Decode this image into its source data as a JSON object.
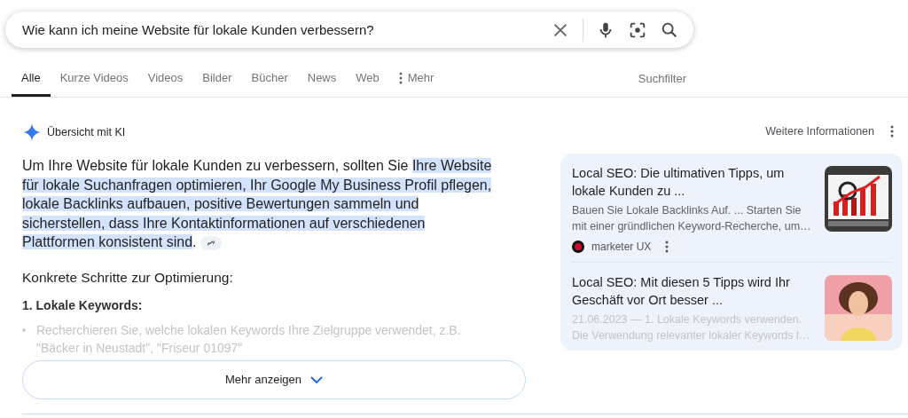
{
  "search": {
    "value": "Wie kann ich meine Website für lokale Kunden verbessern?"
  },
  "tabs": [
    {
      "label": "Alle",
      "selected": true
    },
    {
      "label": "Kurze Videos",
      "selected": false
    },
    {
      "label": "Videos",
      "selected": false
    },
    {
      "label": "Bilder",
      "selected": false
    },
    {
      "label": "Bücher",
      "selected": false
    },
    {
      "label": "News",
      "selected": false
    },
    {
      "label": "Web",
      "selected": false
    },
    {
      "label": "Mehr",
      "selected": false,
      "kind": "more"
    }
  ],
  "filter": "Suchfilter",
  "overview": {
    "title": "Übersicht mit KI",
    "more_info": "Weitere Informationen",
    "answer": [
      {
        "text": "Um Ihre Website für lokale Kunden zu verbessern, sollten Sie ",
        "highlighted": false
      },
      {
        "text": "Ihre Website für lokale Suchanfragen optimieren, Ihr Google My Business Profil pflegen, lokale Backlinks aufbauen, positive Bewertungen sammeln und sicherstellen, dass Ihre Kontaktinformationen auf verschiedenen Plattformen konsistent sind",
        "highlighted": true
      },
      {
        "text": ".",
        "highlighted": false
      }
    ],
    "heading": "Konkrete Schritte zur Optimierung:",
    "step": "1. Lokale Keywords:",
    "bullet": "Recherchieren Sie, welche lokalen Keywords Ihre Zielgruppe verwendet, z.B. \"Bäcker in Neustadt\", \"Friseur 01097\"",
    "show_more": "Mehr anzeigen",
    "sources": [
      {
        "title": "Local SEO: Die ultimativen Tipps, um lokale Kunden zu ...",
        "snippet": "Bauen Sie Lokale Backlinks Auf. ... Starten Sie mit einer gründlichen Keyword-Recherche, um…",
        "site": "marketer UX",
        "kind": "chart"
      },
      {
        "title": "Local SEO: Mit diesen 5 Tipps wird Ihr Geschäft vor Ort besser ...",
        "snippet": "21.06.2023 — 1. Lokale Keywords verwenden. Die Verwendung relevanter lokaler Keywords l…",
        "kind": "person"
      }
    ]
  }
}
